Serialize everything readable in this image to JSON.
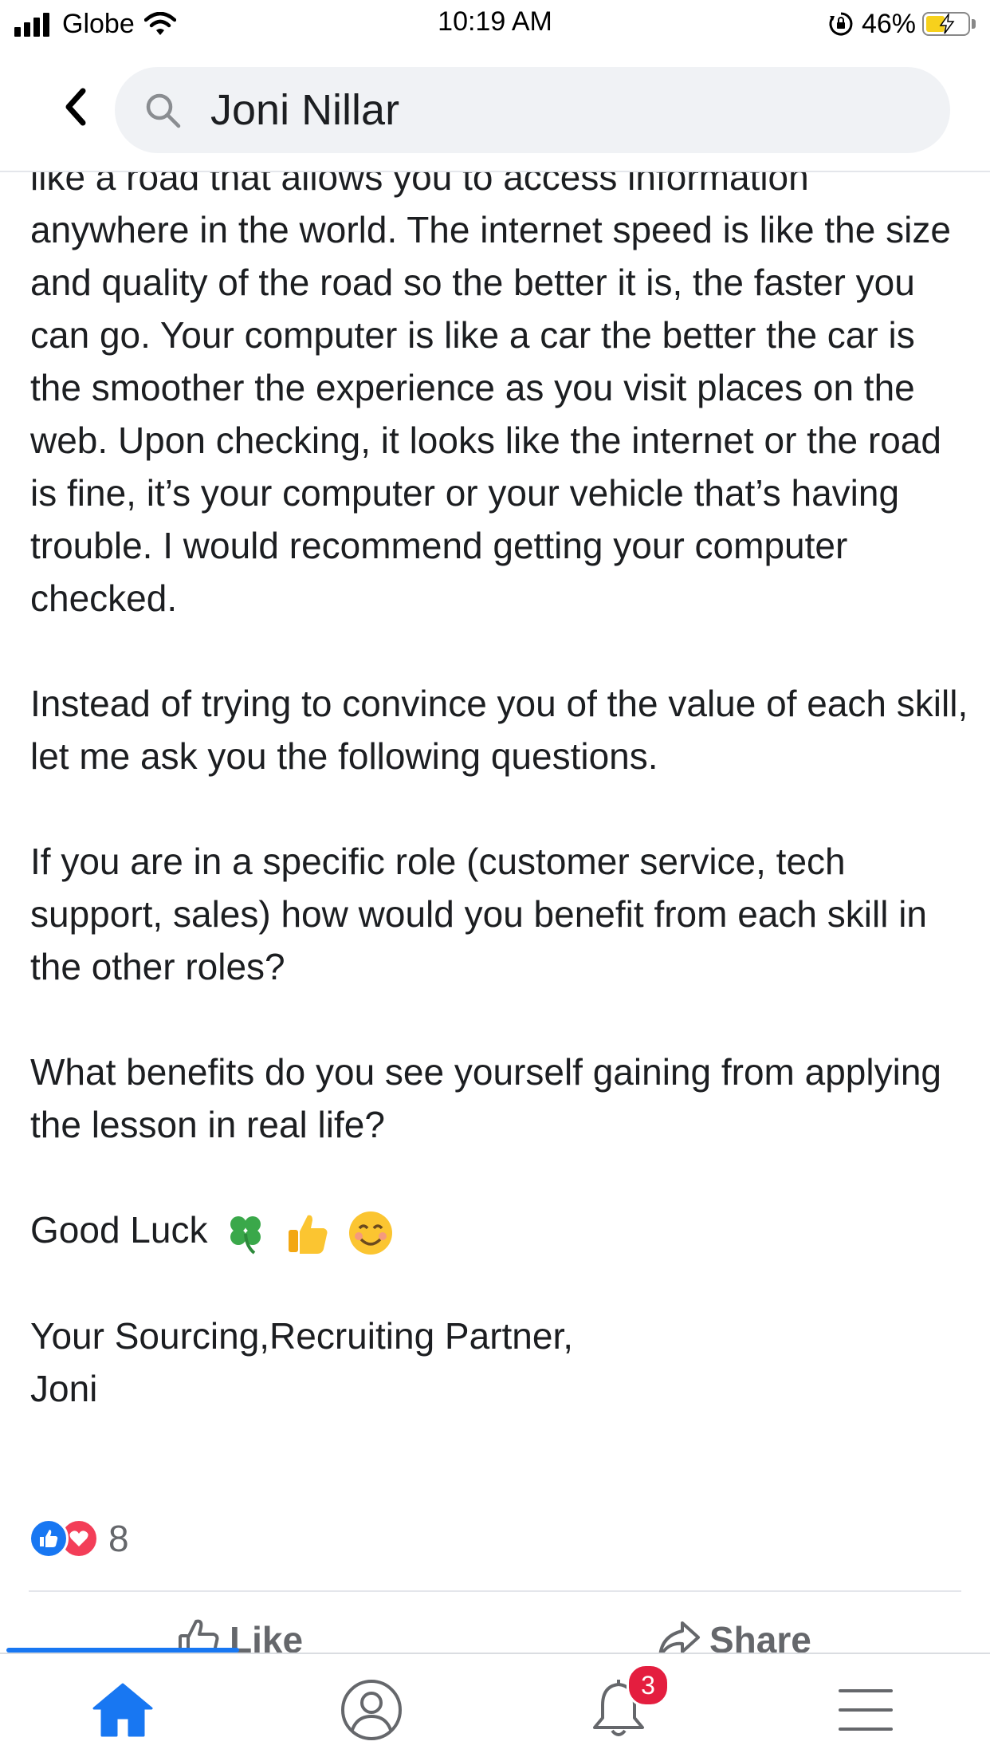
{
  "status_bar": {
    "carrier": "Globe",
    "time": "10:19 AM",
    "battery_percent": "46%",
    "battery_level": 0.46,
    "icons": [
      "signal-icon",
      "wifi-icon",
      "orientation-lock-icon",
      "battery-charging-icon"
    ]
  },
  "header": {
    "back_icon": "chevron-left-icon",
    "search_icon": "search-icon",
    "search_query": "Joni Nillar"
  },
  "post": {
    "paragraphs": [
      "like a road that allows you to access information anywhere in the world. The internet speed is like the size and quality of the road so the better it is, the faster you can go. Your computer is like a car the better the car is the smoother the experience as you visit places on the web. Upon checking, it looks like the internet or the road is fine, it’s your computer or your vehicle that’s having trouble. I would recommend getting your computer checked.",
      "Instead of trying to convince you of the value of each skill, let me ask you the following questions.",
      "If you are in a specific role (customer service, tech support, sales) how would you benefit from each skill in the other roles?",
      "What benefits do you see yourself gaining from applying the lesson in real life?"
    ],
    "good_luck": "Good Luck",
    "good_luck_emojis": [
      "four-leaf-clover-emoji",
      "thumbs-up-emoji",
      "smiling-face-emoji"
    ],
    "signature_line1": "Your Sourcing,Recruiting Partner,",
    "signature_line2": "Joni"
  },
  "reactions": {
    "types": [
      "like-reaction-icon",
      "love-reaction-icon"
    ],
    "count": "8"
  },
  "actions": {
    "like_label": "Like",
    "share_label": "Share"
  },
  "tab_bar": {
    "tabs": [
      "home-icon",
      "profile-icon",
      "notifications-bell-icon",
      "menu-icon"
    ],
    "active_tab": "home",
    "notifications_badge": "3"
  },
  "colors": {
    "accent": "#1877f2",
    "badge": "#e41e3f",
    "love": "#f33e58",
    "text": "#1c1e21",
    "secondary_text": "#65676b"
  }
}
